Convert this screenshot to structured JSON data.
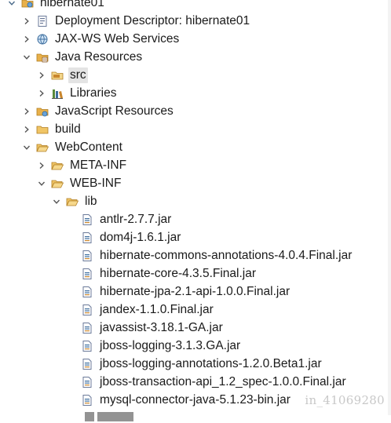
{
  "project": {
    "name": "hibernate01"
  },
  "tree": {
    "deployment_descriptor": "Deployment Descriptor: hibernate01",
    "jaxws": "JAX-WS Web Services",
    "java_resources": "Java Resources",
    "src": "src",
    "libraries": "Libraries",
    "javascript_resources": "JavaScript Resources",
    "build": "build",
    "webcontent": "WebContent",
    "meta_inf": "META-INF",
    "web_inf": "WEB-INF",
    "lib": "lib",
    "jars": [
      "antlr-2.7.7.jar",
      "dom4j-1.6.1.jar",
      "hibernate-commons-annotations-4.0.4.Final.jar",
      "hibernate-core-4.3.5.Final.jar",
      "hibernate-jpa-2.1-api-1.0.0.Final.jar",
      "jandex-1.1.0.Final.jar",
      "javassist-3.18.1-GA.jar",
      "jboss-logging-3.1.3.GA.jar",
      "jboss-logging-annotations-1.2.0.Beta1.jar",
      "jboss-transaction-api_1.2_spec-1.0.0.Final.jar",
      "mysql-connector-java-5.1.23-bin.jar"
    ]
  },
  "watermark": "in_41069280",
  "colors": {
    "folder": "#e8b04a",
    "jar": "#6b7a99",
    "selection": "#e4e4e4"
  }
}
